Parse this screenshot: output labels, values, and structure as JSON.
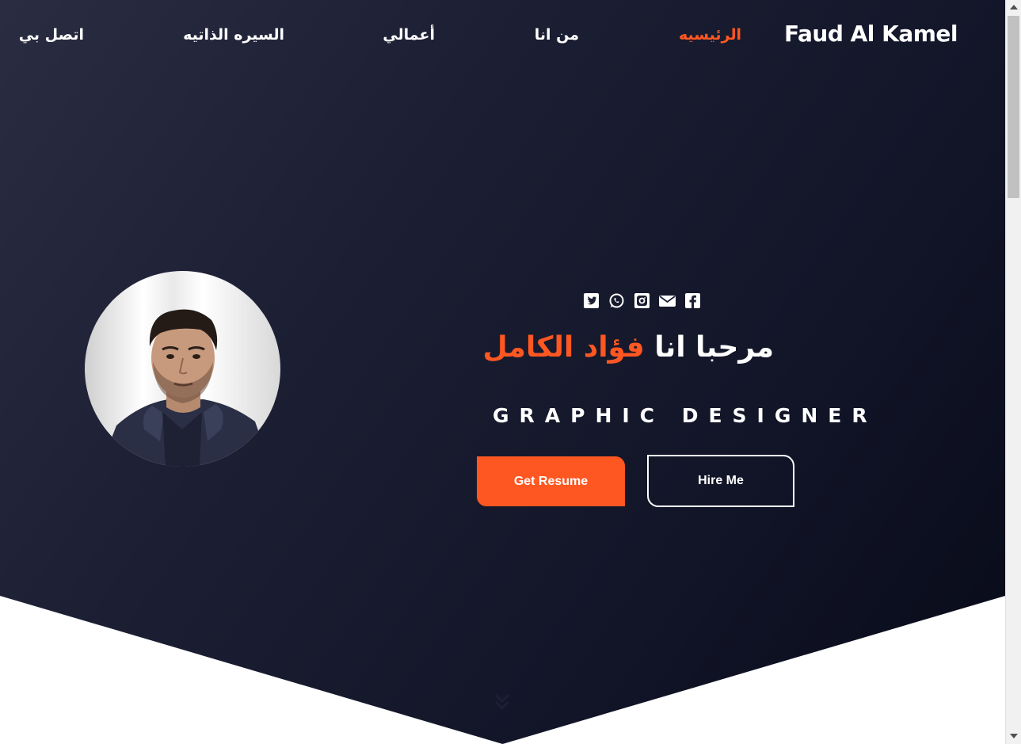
{
  "brand": "Faud Al Kamel",
  "nav": {
    "items": [
      {
        "label": "الرئيسيه",
        "active": true
      },
      {
        "label": "من انا",
        "active": false
      },
      {
        "label": "أعمالي",
        "active": false
      },
      {
        "label": "السيره الذاتيه",
        "active": false
      },
      {
        "label": "اتصل بي",
        "active": false
      }
    ]
  },
  "hero": {
    "socials": [
      "twitter-icon",
      "whatsapp-icon",
      "instagram-icon",
      "email-icon",
      "facebook-icon"
    ],
    "greeting": "مرحبا انا",
    "name": "فؤاد الكامل",
    "role": "GRAPHIC DESIGNER",
    "resume_label": "Get Resume",
    "hire_label": "Hire Me"
  },
  "colors": {
    "accent": "#ff5722",
    "hero_background": "#1c1f33",
    "text": "#ffffff"
  }
}
